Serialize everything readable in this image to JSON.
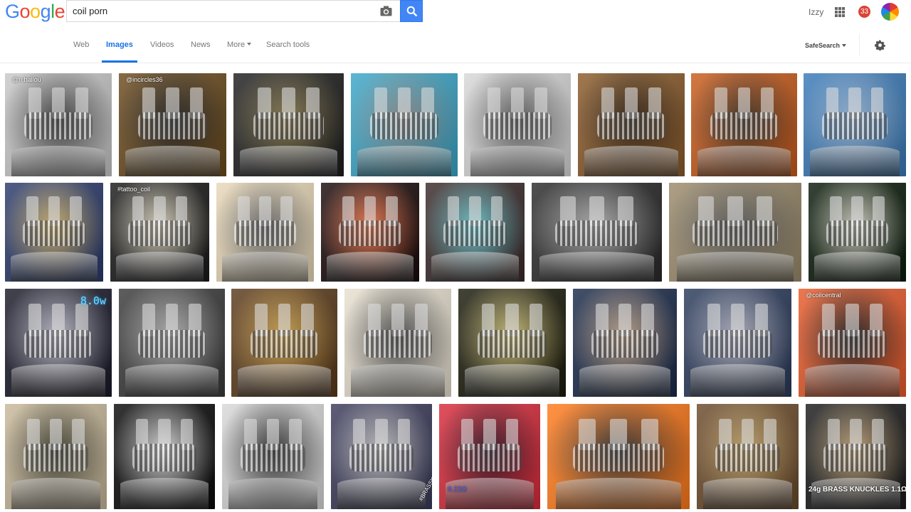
{
  "header": {
    "logo_letters": [
      {
        "ch": "G",
        "color": "#4285f4"
      },
      {
        "ch": "o",
        "color": "#ea4335"
      },
      {
        "ch": "o",
        "color": "#fbbc05"
      },
      {
        "ch": "g",
        "color": "#4285f4"
      },
      {
        "ch": "l",
        "color": "#34a853"
      },
      {
        "ch": "e",
        "color": "#ea4335"
      }
    ],
    "search_value": "coil porn",
    "camera_icon": "camera-icon",
    "search_button_icon": "magnifier-icon",
    "user_name": "Izzy",
    "apps_icon": "apps-grid-icon",
    "notification_count": "33",
    "avatar_icon": "rainbow-avatar"
  },
  "nav": {
    "tabs": [
      {
        "label": "Web",
        "active": false
      },
      {
        "label": "Images",
        "active": true
      },
      {
        "label": "Videos",
        "active": false
      },
      {
        "label": "News",
        "active": false
      },
      {
        "label": "More",
        "active": false,
        "dropdown": true
      },
      {
        "label": "Search tools",
        "active": false
      }
    ],
    "safesearch_label": "SafeSearch",
    "settings_icon": "gear-icon",
    "accent_color": "#1a73e8"
  },
  "results": {
    "rows": [
      [
        {
          "caption": "@n.ballou",
          "palette": [
            "#c8c8c8",
            "#3a3a3a"
          ]
        },
        {
          "caption": "@incircles36",
          "palette": [
            "#6b4a1c",
            "#1a1a1a"
          ]
        },
        {
          "caption": "",
          "palette": [
            "#1e1e1e",
            "#8a7a4a"
          ]
        },
        {
          "caption": "",
          "palette": [
            "#3aa6c8",
            "#8a8a8a"
          ]
        },
        {
          "caption": "",
          "palette": [
            "#d8d8d8",
            "#5a5a5a"
          ]
        },
        {
          "caption": "",
          "palette": [
            "#8a5a2a",
            "#2a1a0a"
          ]
        },
        {
          "caption": "",
          "palette": [
            "#c85a1a",
            "#3a2a1a"
          ]
        },
        {
          "caption": "",
          "palette": [
            "#3a7ab8",
            "#9ab8d8"
          ]
        }
      ],
      [
        {
          "caption": "",
          "palette": [
            "#2a3a6a",
            "#d8b86a"
          ]
        },
        {
          "caption": "#tattoo_coil",
          "palette": [
            "#1a1a1a",
            "#e8e0c8"
          ]
        },
        {
          "caption": "",
          "palette": [
            "#e8d8b8",
            "#6a6a6a"
          ]
        },
        {
          "caption": "",
          "palette": [
            "#1a0a0a",
            "#ff7a4a"
          ]
        },
        {
          "caption": "",
          "palette": [
            "#3a2a2a",
            "#6ad0d8"
          ]
        },
        {
          "caption": "",
          "palette": [
            "#2a2a2a",
            "#b8b8b8"
          ]
        },
        {
          "caption": "",
          "palette": [
            "#9a8a6a",
            "#5a5a5a"
          ]
        },
        {
          "caption": "",
          "palette": [
            "#0a1a0a",
            "#d8d8c8"
          ]
        }
      ],
      [
        {
          "caption": "8.0w",
          "display": true,
          "palette": [
            "#1a1a2a",
            "#c8c8d8"
          ]
        },
        {
          "caption": "",
          "palette": [
            "#3a3a3a",
            "#b8b8b8"
          ]
        },
        {
          "caption": "",
          "palette": [
            "#5a3a1a",
            "#d8a84a"
          ]
        },
        {
          "caption": "",
          "palette": [
            "#e8e0d0",
            "#4a4a4a"
          ]
        },
        {
          "caption": "",
          "palette": [
            "#1a1a0a",
            "#d8c87a"
          ]
        },
        {
          "caption": "",
          "palette": [
            "#1a2a4a",
            "#c8a88a"
          ]
        },
        {
          "caption": "",
          "palette": [
            "#2a3a5a",
            "#b8b8c8"
          ]
        },
        {
          "caption": "@coilcentral",
          "palette": [
            "#e85a2a",
            "#1a1a1a"
          ]
        }
      ],
      [
        {
          "caption": "",
          "palette": [
            "#c8b89a",
            "#3a3a2a"
          ]
        },
        {
          "caption": "",
          "palette": [
            "#0a0a0a",
            "#e8e8e8"
          ]
        },
        {
          "caption": "",
          "palette": [
            "#d8d8d8",
            "#2a2a2a"
          ]
        },
        {
          "caption": "#BRASSKNUCKLES",
          "palette": [
            "#3a3a5a",
            "#c8c8c8"
          ]
        },
        {
          "caption": "0.22Ω",
          "palette": [
            "#d82a3a",
            "#2a0a1a"
          ]
        },
        {
          "caption": "",
          "palette": [
            "#ff7a1a",
            "#2a2a2a"
          ]
        },
        {
          "caption": "",
          "palette": [
            "#6a4a2a",
            "#c8a86a"
          ]
        },
        {
          "caption": "24g BRASS KNUCKLES 1.1Ω",
          "bold": true,
          "palette": [
            "#1a1a1a",
            "#c8a87a"
          ]
        }
      ]
    ]
  }
}
